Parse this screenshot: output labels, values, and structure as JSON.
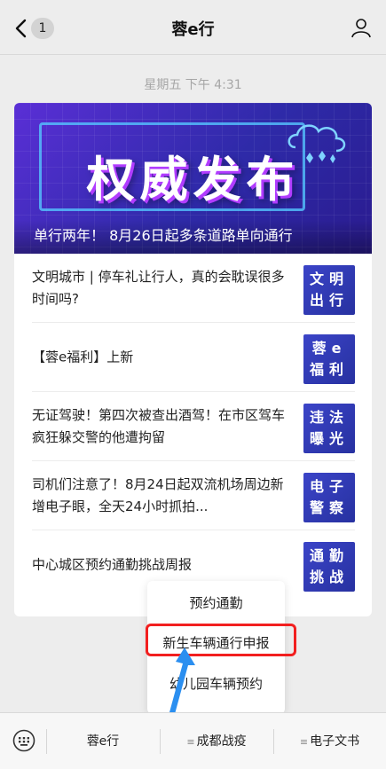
{
  "header": {
    "badge_count": "1",
    "title": "蓉e行"
  },
  "timestamp": "星期五 下午 4:31",
  "hero": {
    "banner_text": "权威发布",
    "caption": "单行两年！ 8月26日起多条道路单向通行"
  },
  "articles": [
    {
      "title": "文明城市 | 停车礼让行人，真的会耽误很多时间吗?",
      "thumb": "文明出行"
    },
    {
      "title": "【蓉e福利】上新",
      "thumb": "蓉e福利"
    },
    {
      "title": "无证驾驶！第四次被查出酒驾！在市区驾车疯狂躲交警的他遭拘留",
      "thumb": "违法曝光"
    },
    {
      "title": "司机们注意了！8月24日起双流机场周边新增电子眼，全天24小时抓拍...",
      "thumb": "电子警察"
    },
    {
      "title": "中心城区预约通勤挑战周报",
      "thumb": "通勤挑战"
    }
  ],
  "popup_menu": {
    "items": [
      "预约通勤",
      "新生车辆通行申报",
      "幼儿园车辆预约"
    ]
  },
  "bottom_menu": {
    "items": [
      "蓉e行",
      "成都战疫",
      "电子文书"
    ]
  },
  "colors": {
    "highlight": "#f21f1f",
    "arrow": "#2b8ff0",
    "hero": "#2e2aa8"
  }
}
